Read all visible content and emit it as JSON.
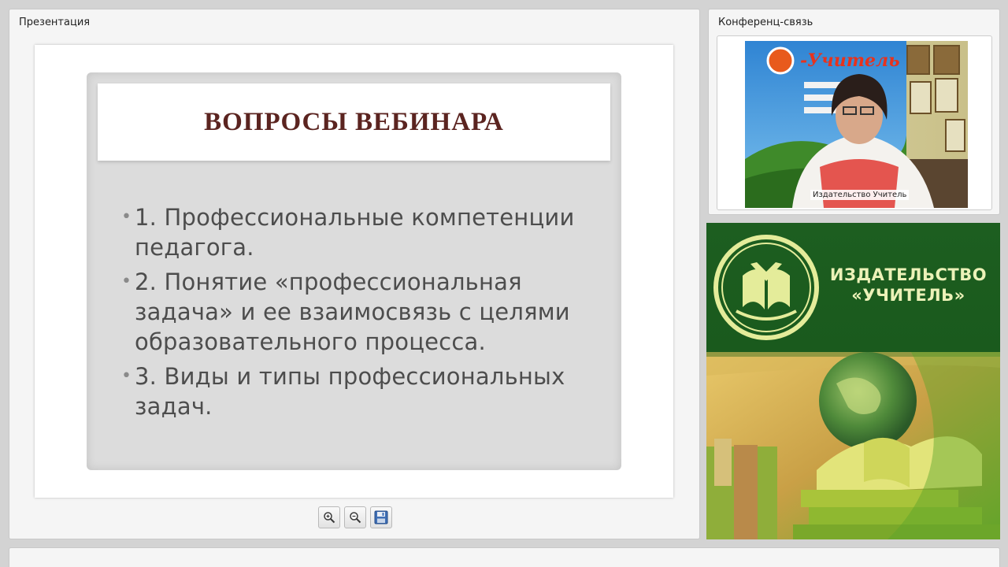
{
  "presentation": {
    "panel_title": "Презентация",
    "slide": {
      "title": "ВОПРОСЫ ВЕБИНАРА",
      "bullets": [
        "1. Профессиональные компетенции педагога.",
        "2. Понятие «профессиональная задача» и ее взаимосвязь с целями образовательного процесса.",
        "3. Виды и типы профессиональных задач."
      ]
    },
    "toolbar": {
      "zoom_in_icon": "zoom-in-icon",
      "zoom_out_icon": "zoom-out-icon",
      "save_icon": "floppy-disk-icon"
    }
  },
  "conference": {
    "panel_title": "Конференц-связь",
    "participant_name": "Издательство Учитель"
  },
  "banner": {
    "line1": "ИЗДАТЕЛЬСТВО",
    "line2": "«УЧИТЕЛЬ»"
  },
  "colors": {
    "slide_title": "#5b2420",
    "banner_green": "#1d5e20",
    "banner_text": "#ecf2b8"
  }
}
